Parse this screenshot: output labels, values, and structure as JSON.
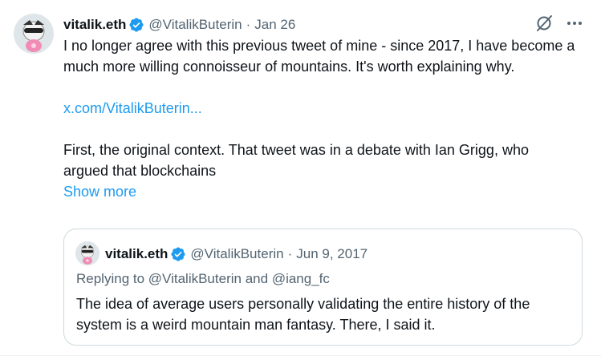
{
  "tweet": {
    "author_name": "vitalik.eth",
    "handle": "@VitalikButerin",
    "separator": "·",
    "time": "Jan 26",
    "paragraph1": "I no longer agree with this previous tweet of mine - since 2017, I have become a much more willing connoisseur of mountains. It's worth explaining why.",
    "link_text": "x.com/VitalikButerin...",
    "paragraph2": "First, the original context. That tweet was in a debate with Ian Grigg, who argued that blockchains",
    "show_more": "Show more",
    "icons": {
      "verified": "verified-badge-icon",
      "grok": "grok-icon",
      "more": "more-icon"
    }
  },
  "quote": {
    "author_name": "vitalik.eth",
    "handle": "@VitalikButerin",
    "separator": "·",
    "time": "Jun 9, 2017",
    "replying_to_prefix": "Replying to",
    "mention1": "@VitalikButerin",
    "and_word": "and",
    "mention2": "@iang_fc",
    "text": "The idea of average users personally validating the entire history of the system is a weird mountain man fantasy. There, I said it."
  },
  "colors": {
    "accent": "#1d9bf0",
    "text": "#0f1419",
    "secondary": "#536471",
    "border": "#cfd9de"
  }
}
